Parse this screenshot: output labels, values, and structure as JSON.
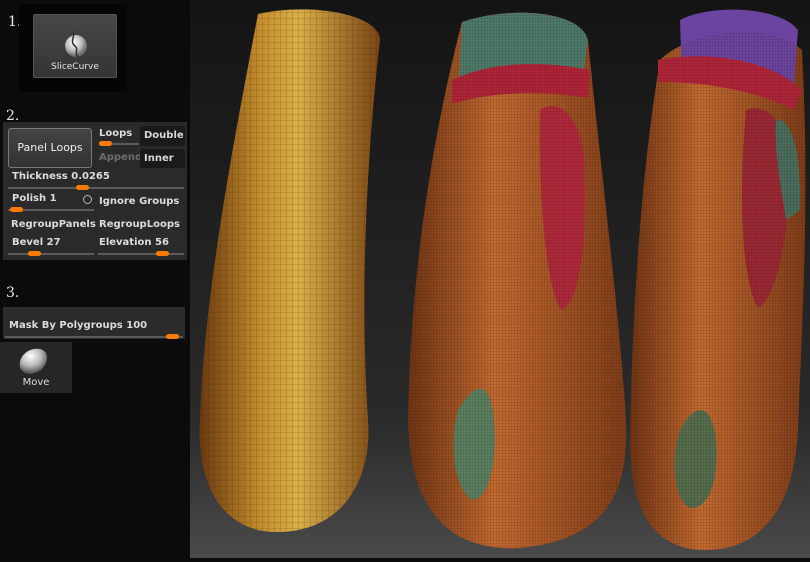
{
  "steps": {
    "one": "1.",
    "two": "2.",
    "three": "3."
  },
  "slice_tool": {
    "label": "SliceCurve",
    "icon": "slice-curve-icon"
  },
  "panel": {
    "panel_loops": "Panel Loops",
    "loops": "Loops",
    "double": "Double",
    "append": "Append",
    "inner": "Inner",
    "thickness_label": "Thickness",
    "thickness_value": "0.0265",
    "polish_label": "Polish",
    "polish_value": "1",
    "ignore_groups": "Ignore Groups",
    "regroup_panels": "RegroupPanels",
    "regroup_loops": "RegroupLoops",
    "bevel_label": "Bevel",
    "bevel_value": "27",
    "elevation_label": "Elevation",
    "elevation_value": "56"
  },
  "mask": {
    "label": "Mask By Polygroups",
    "value": "100"
  },
  "move_brush": {
    "label": "Move",
    "icon": "move-brush-icon"
  },
  "colors": {
    "accent": "#ff7a00",
    "panel_bg": "#2a2a2a",
    "viewport_bg": "#1c1c1c"
  }
}
